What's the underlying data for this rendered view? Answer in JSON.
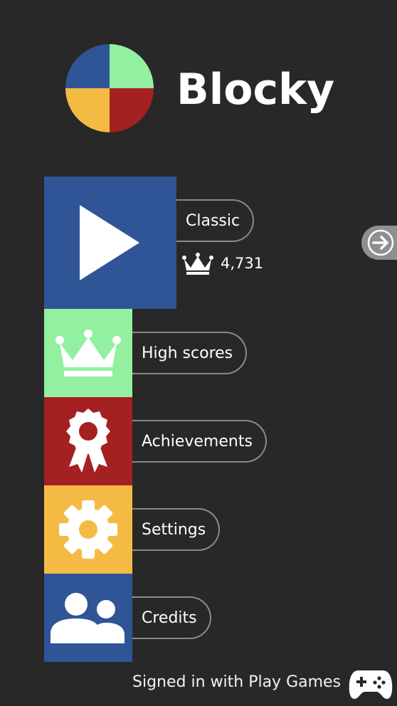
{
  "app": {
    "title": "Blocky"
  },
  "logo": {
    "colors": [
      "#2f5597",
      "#93f0a0",
      "#f4bb44",
      "#a52020"
    ]
  },
  "menu": {
    "play": {
      "label": "Classic",
      "high_score": "4,731",
      "color": "#2f5597"
    },
    "high_scores": {
      "label": "High scores",
      "color": "#93f0a0"
    },
    "achievements": {
      "label": "Achievements",
      "color": "#a52020"
    },
    "settings": {
      "label": "Settings",
      "color": "#f4bb44"
    },
    "credits": {
      "label": "Credits",
      "color": "#2f5597"
    }
  },
  "footer": {
    "status": "Signed in with Play Games"
  },
  "icons": [
    "play-icon",
    "crown-icon",
    "award-ribbon-icon",
    "gear-icon",
    "people-icon",
    "arrow-right-icon",
    "gamepad-icon"
  ]
}
